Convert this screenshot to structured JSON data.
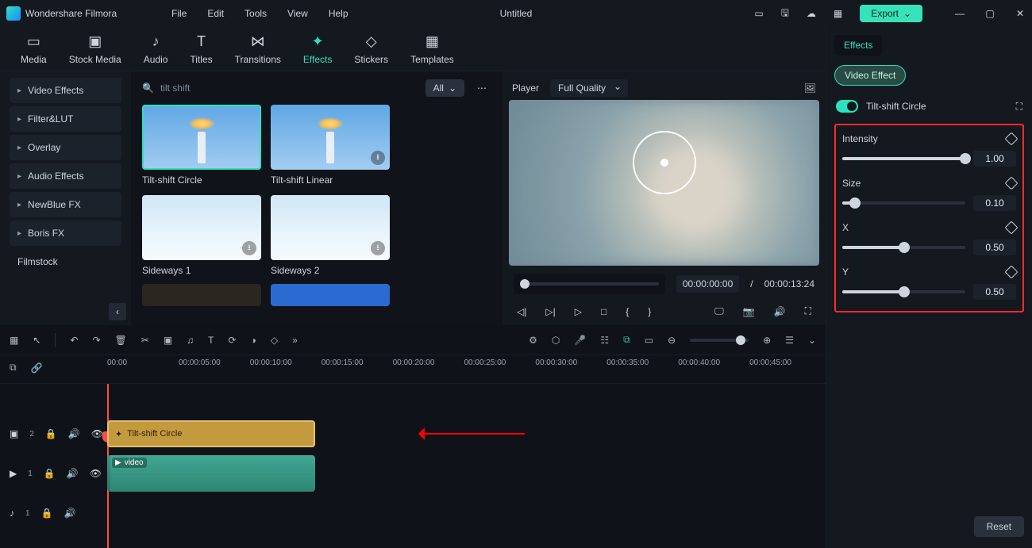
{
  "app": {
    "name": "Wondershare Filmora",
    "document_title": "Untitled"
  },
  "menubar": [
    "File",
    "Edit",
    "Tools",
    "View",
    "Help"
  ],
  "export_label": "Export",
  "tabs": {
    "items": [
      "Media",
      "Stock Media",
      "Audio",
      "Titles",
      "Transitions",
      "Effects",
      "Stickers",
      "Templates"
    ],
    "active": "Effects"
  },
  "sidebar": {
    "items": [
      "Video Effects",
      "Filter&LUT",
      "Overlay",
      "Audio Effects",
      "NewBlue FX",
      "Boris FX",
      "Filmstock"
    ]
  },
  "gallery": {
    "search_placeholder": "tilt shift",
    "filter_label": "All",
    "items": [
      {
        "label": "Tilt-shift Circle"
      },
      {
        "label": "Tilt-shift Linear"
      },
      {
        "label": "Sideways 1"
      },
      {
        "label": "Sideways 2"
      }
    ]
  },
  "preview": {
    "title": "Player",
    "quality_label": "Full Quality",
    "time_current": "00:00:00:00",
    "time_total": "00:00:13:24"
  },
  "right_panel": {
    "tab": "Effects",
    "chip": "Video Effect",
    "effect_name": "Tilt-shift Circle",
    "props": [
      {
        "label": "Intensity",
        "value": "1.00",
        "pct": 100
      },
      {
        "label": "Size",
        "value": "0.10",
        "pct": 10
      },
      {
        "label": "X",
        "value": "0.50",
        "pct": 50
      },
      {
        "label": "Y",
        "value": "0.50",
        "pct": 50
      }
    ],
    "reset": "Reset"
  },
  "timeline": {
    "ruler": [
      "00:00",
      "00:00:05:00",
      "00:00:10:00",
      "00:00:15:00",
      "00:00:20:00",
      "00:00:25:00",
      "00:00:30:00",
      "00:00:35:00",
      "00:00:40:00",
      "00:00:45:00"
    ],
    "effect_clip_label": "Tilt-shift Circle",
    "video_clip_label": "video",
    "track_heads": {
      "fx": "2",
      "v1": "1",
      "a1": "1"
    }
  }
}
